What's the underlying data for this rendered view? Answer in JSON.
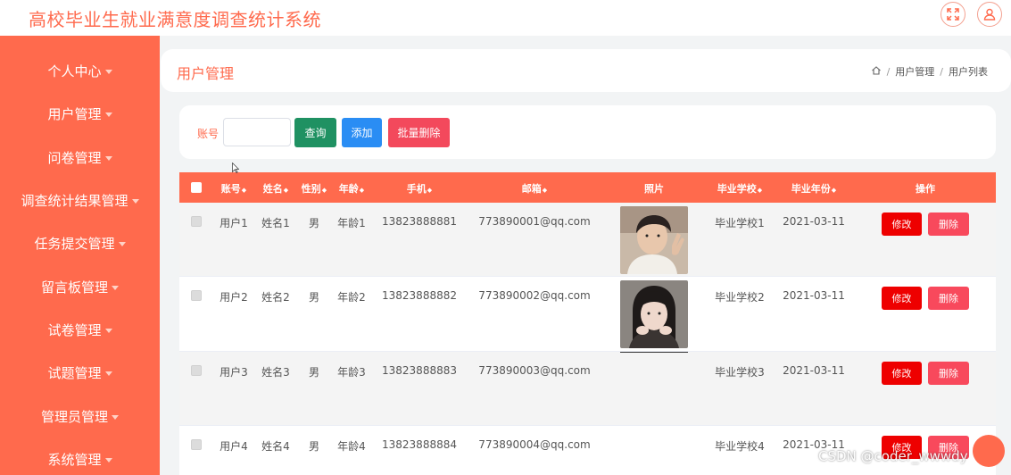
{
  "app": {
    "title": "高校毕业生就业满意度调查统计系统"
  },
  "icons": {
    "fullscreen": "expand-icon",
    "user": "user-icon",
    "home": "home-icon"
  },
  "colors": {
    "primary": "#ff6a4d",
    "query": "#1f9162",
    "add": "#2a8df4",
    "bulk_delete": "#f3495c",
    "edit": "#ee0000",
    "delete": "#f8495c"
  },
  "sidebar": {
    "items": [
      {
        "label": "个人中心"
      },
      {
        "label": "用户管理"
      },
      {
        "label": "问卷管理"
      },
      {
        "label": "调查统计结果管理"
      },
      {
        "label": "任务提交管理"
      },
      {
        "label": "留言板管理"
      },
      {
        "label": "试卷管理"
      },
      {
        "label": "试题管理"
      },
      {
        "label": "管理员管理"
      },
      {
        "label": "系统管理"
      }
    ]
  },
  "page": {
    "title": "用户管理",
    "breadcrumb": [
      "用户管理",
      "用户列表"
    ]
  },
  "search": {
    "label": "账号",
    "value": "",
    "placeholder": "",
    "query_label": "查询",
    "add_label": "添加",
    "bulk_delete_label": "批量删除"
  },
  "table": {
    "headers": {
      "account": "账号",
      "name": "姓名",
      "gender": "性别",
      "age": "年龄",
      "phone": "手机",
      "email": "邮箱",
      "photo": "照片",
      "school": "毕业学校",
      "year": "毕业年份",
      "actions": "操作"
    },
    "edit_label": "修改",
    "delete_label": "删除",
    "rows": [
      {
        "account": "用户1",
        "name": "姓名1",
        "gender": "男",
        "age": "年龄1",
        "phone": "13823888881",
        "email": "773890001@qq.com",
        "photo": "male-portrait",
        "school": "毕业学校1",
        "year": "2021-03-11"
      },
      {
        "account": "用户2",
        "name": "姓名2",
        "gender": "男",
        "age": "年龄2",
        "phone": "13823888882",
        "email": "773890002@qq.com",
        "photo": "female-portrait",
        "school": "毕业学校2",
        "year": "2021-03-11"
      },
      {
        "account": "用户3",
        "name": "姓名3",
        "gender": "男",
        "age": "年龄3",
        "phone": "13823888883",
        "email": "773890003@qq.com",
        "photo": "",
        "school": "毕业学校3",
        "year": "2021-03-11"
      },
      {
        "account": "用户4",
        "name": "姓名4",
        "gender": "男",
        "age": "年龄4",
        "phone": "13823888884",
        "email": "773890004@qq.com",
        "photo": "",
        "school": "毕业学校4",
        "year": "2021-03-11"
      }
    ]
  },
  "watermark": "CSDN @coder_wwwdy"
}
